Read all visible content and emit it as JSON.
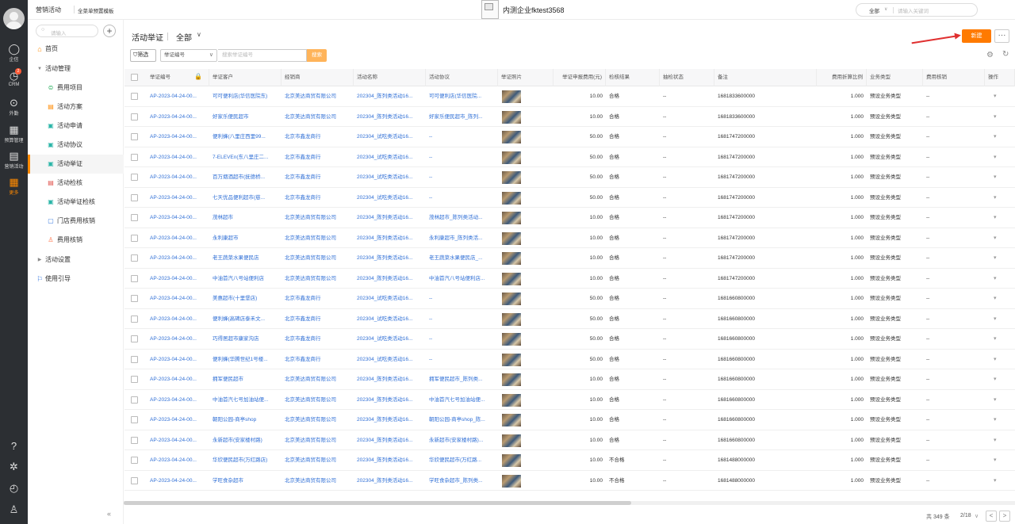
{
  "leftbar": {
    "items": [
      {
        "label": "企信",
        "icon": "chat-icon"
      },
      {
        "label": "CRM",
        "icon": "crm-icon",
        "badge": "2"
      },
      {
        "label": "外勤",
        "icon": "location-icon"
      },
      {
        "label": "预算管理",
        "icon": "budget-icon"
      },
      {
        "label": "营销活动",
        "icon": "clipboard-icon"
      },
      {
        "label": "更多",
        "icon": "grid-icon"
      }
    ],
    "bottom_icons": [
      "help-icon",
      "settings-icon",
      "clock-icon",
      "contacts-icon"
    ]
  },
  "topbar": {
    "title": "营销活动",
    "subtitle": "全菜单预置模板",
    "company": "内测企业fktest3568",
    "search_scope": "全部",
    "search_placeholder": "请输入关键词"
  },
  "sidebar": {
    "search_placeholder": "请输入",
    "items": [
      {
        "label": "首页",
        "icon": "home-icon",
        "level": 0
      },
      {
        "label": "活动管理",
        "icon": "triangle-down-icon",
        "level": 0
      },
      {
        "label": "费用项目",
        "icon": "coin-icon",
        "level": 1
      },
      {
        "label": "活动方案",
        "icon": "doc-icon",
        "level": 1
      },
      {
        "label": "活动申请",
        "icon": "apply-icon",
        "level": 1
      },
      {
        "label": "活动协议",
        "icon": "agreement-icon",
        "level": 1
      },
      {
        "label": "活动举证",
        "icon": "proof-icon",
        "level": 1,
        "active": true
      },
      {
        "label": "活动检核",
        "icon": "check-icon",
        "level": 1
      },
      {
        "label": "活动举证检核",
        "icon": "proof-check-icon",
        "level": 1
      },
      {
        "label": "门店费用核销",
        "icon": "store-icon",
        "level": 1
      },
      {
        "label": "费用核销",
        "icon": "person-icon",
        "level": 1
      },
      {
        "label": "活动设置",
        "icon": "triangle-right-icon",
        "level": 0
      },
      {
        "label": "使用引导",
        "icon": "flag-icon",
        "level": 0
      }
    ]
  },
  "page": {
    "title": "活动举证",
    "view": "全部",
    "new_button": "新建",
    "more_button": "···",
    "filter_button": "筛选",
    "filter_field": "举证编号",
    "filter_placeholder": "搜索举证编号",
    "search_button": "搜索"
  },
  "table": {
    "columns": [
      "举证编号",
      "举证客户",
      "经销商",
      "活动名称",
      "活动协议",
      "举证照片",
      "举证申报费用(元)",
      "检核结果",
      "抽检状态",
      "备注",
      "费用折算比例",
      "业务类型",
      "费用核销",
      "操作"
    ],
    "rows": [
      [
        "AP-2023-04-24-00...",
        "可可便利店(华信医院东)",
        "北京美达商贸有限公司",
        "202304_陈列类活动16...",
        "可可便利店(华信医院...",
        "",
        "10.00",
        "合格",
        "--",
        "1681833600000",
        "1.000",
        "预设业务类型",
        "--"
      ],
      [
        "AP-2023-04-24-00...",
        "好家乐便民超市",
        "北京美达商贸有限公司",
        "202304_陈列类活动16...",
        "好家乐便民超市_陈列...",
        "",
        "10.00",
        "合格",
        "--",
        "1681833600000",
        "1.000",
        "预设业务类型",
        "--"
      ],
      [
        "AP-2023-04-24-00...",
        "便利蜂(八里庄西里99...",
        "北京市鑫龙商行",
        "202304_试吃类活动16...",
        "--",
        "",
        "50.00",
        "合格",
        "--",
        "1681747200000",
        "1.000",
        "预设业务类型",
        "--"
      ],
      [
        "AP-2023-04-24-00...",
        "7-ELEVEn(东八里庄二...",
        "北京市鑫龙商行",
        "202304_试吃类活动16...",
        "--",
        "",
        "50.00",
        "合格",
        "--",
        "1681747200000",
        "1.000",
        "预设业务类型",
        "--"
      ],
      [
        "AP-2023-04-24-00...",
        "百万烟酒超市(抚德桥...",
        "北京市鑫龙商行",
        "202304_试吃类活动16...",
        "--",
        "",
        "50.00",
        "合格",
        "--",
        "1681747200000",
        "1.000",
        "预设业务类型",
        "--"
      ],
      [
        "AP-2023-04-24-00...",
        "七天优品便利超市(慈...",
        "北京市鑫龙商行",
        "202304_试吃类活动16...",
        "--",
        "",
        "50.00",
        "合格",
        "--",
        "1681747200000",
        "1.000",
        "预设业务类型",
        "--"
      ],
      [
        "AP-2023-04-24-00...",
        "茂林超市",
        "北京美达商贸有限公司",
        "202304_陈列类活动16...",
        "茂林超市_陈列类活动...",
        "",
        "10.00",
        "合格",
        "--",
        "1681747200000",
        "1.000",
        "预设业务类型",
        "--"
      ],
      [
        "AP-2023-04-24-00...",
        "永利康超市",
        "北京美达商贸有限公司",
        "202304_陈列类活动16...",
        "永利康超市_陈列类活...",
        "",
        "10.00",
        "合格",
        "--",
        "1681747200000",
        "1.000",
        "预设业务类型",
        "--"
      ],
      [
        "AP-2023-04-24-00...",
        "老王蔬菜水果便民店",
        "北京美达商贸有限公司",
        "202304_陈列类活动16...",
        "老王蔬菜水果便民店_...",
        "",
        "10.00",
        "合格",
        "--",
        "1681747200000",
        "1.000",
        "预设业务类型",
        "--"
      ],
      [
        "AP-2023-04-24-00...",
        "中油首汽八号站便利店",
        "北京美达商贸有限公司",
        "202304_陈列类活动16...",
        "中油首汽八号站便利店...",
        "",
        "10.00",
        "合格",
        "--",
        "1681747200000",
        "1.000",
        "预设业务类型",
        "--"
      ],
      [
        "AP-2023-04-24-00...",
        "美惠超市(十里堡店)",
        "北京市鑫龙商行",
        "202304_试吃类活动16...",
        "--",
        "",
        "50.00",
        "合格",
        "--",
        "1681660800000",
        "1.000",
        "预设业务类型",
        "--"
      ],
      [
        "AP-2023-04-24-00...",
        "便利蜂(高碑店泰禾文...",
        "北京市鑫龙商行",
        "202304_试吃类活动16...",
        "--",
        "",
        "50.00",
        "合格",
        "--",
        "1681660800000",
        "1.000",
        "预设业务类型",
        "--"
      ],
      [
        "AP-2023-04-24-00...",
        "巧得居超市康家沟店",
        "北京市鑫龙商行",
        "202304_试吃类活动16...",
        "--",
        "",
        "50.00",
        "合格",
        "--",
        "1681660800000",
        "1.000",
        "预设业务类型",
        "--"
      ],
      [
        "AP-2023-04-24-00...",
        "便利蜂(华腾世纪1号楼...",
        "北京市鑫龙商行",
        "202304_试吃类活动16...",
        "--",
        "",
        "50.00",
        "合格",
        "--",
        "1681660800000",
        "1.000",
        "预设业务类型",
        "--"
      ],
      [
        "AP-2023-04-24-00...",
        "拥军便民超市",
        "北京美达商贸有限公司",
        "202304_陈列类活动16...",
        "拥军便民超市_陈列类...",
        "",
        "10.00",
        "合格",
        "--",
        "1681660800000",
        "1.000",
        "预设业务类型",
        "--"
      ],
      [
        "AP-2023-04-24-00...",
        "中油首汽七号加油站便...",
        "北京美达商贸有限公司",
        "202304_陈列类活动16...",
        "中油首汽七号加油站便...",
        "",
        "10.00",
        "合格",
        "--",
        "1681660800000",
        "1.000",
        "预设业务类型",
        "--"
      ],
      [
        "AP-2023-04-24-00...",
        "朝阳公园-商亭shop",
        "北京美达商贸有限公司",
        "202304_陈列类活动16...",
        "朝阳公园-商亭shop_陈...",
        "",
        "10.00",
        "合格",
        "--",
        "1681660800000",
        "1.000",
        "预设业务类型",
        "--"
      ],
      [
        "AP-2023-04-24-00...",
        "永新超市(安家楼村路)",
        "北京美达商贸有限公司",
        "202304_陈列类活动16...",
        "永新超市(安家楼村路)...",
        "",
        "10.00",
        "合格",
        "--",
        "1681660800000",
        "1.000",
        "预设业务类型",
        "--"
      ],
      [
        "AP-2023-04-24-00...",
        "华欣便民超市(万红路店)",
        "北京美达商贸有限公司",
        "202304_陈列类活动16...",
        "华欣便民超市(万红路...",
        "",
        "10.00",
        "不合格",
        "--",
        "1681488000000",
        "1.000",
        "预设业务类型",
        "--"
      ],
      [
        "AP-2023-04-24-00...",
        "学旺食杂超市",
        "北京美达商贸有限公司",
        "202304_陈列类活动16...",
        "学旺食杂超市_陈列类...",
        "",
        "10.00",
        "不合格",
        "--",
        "1681488000000",
        "1.000",
        "预设业务类型",
        "--"
      ]
    ]
  },
  "pagination": {
    "total": "共 349 条",
    "page": "2/18",
    "page_arrow": "∨",
    "prev": "<",
    "next": ">"
  },
  "colors": {
    "accent": "#ff7a00",
    "link": "#2f6fd6",
    "sidebar_dark": "#2c2f33"
  }
}
